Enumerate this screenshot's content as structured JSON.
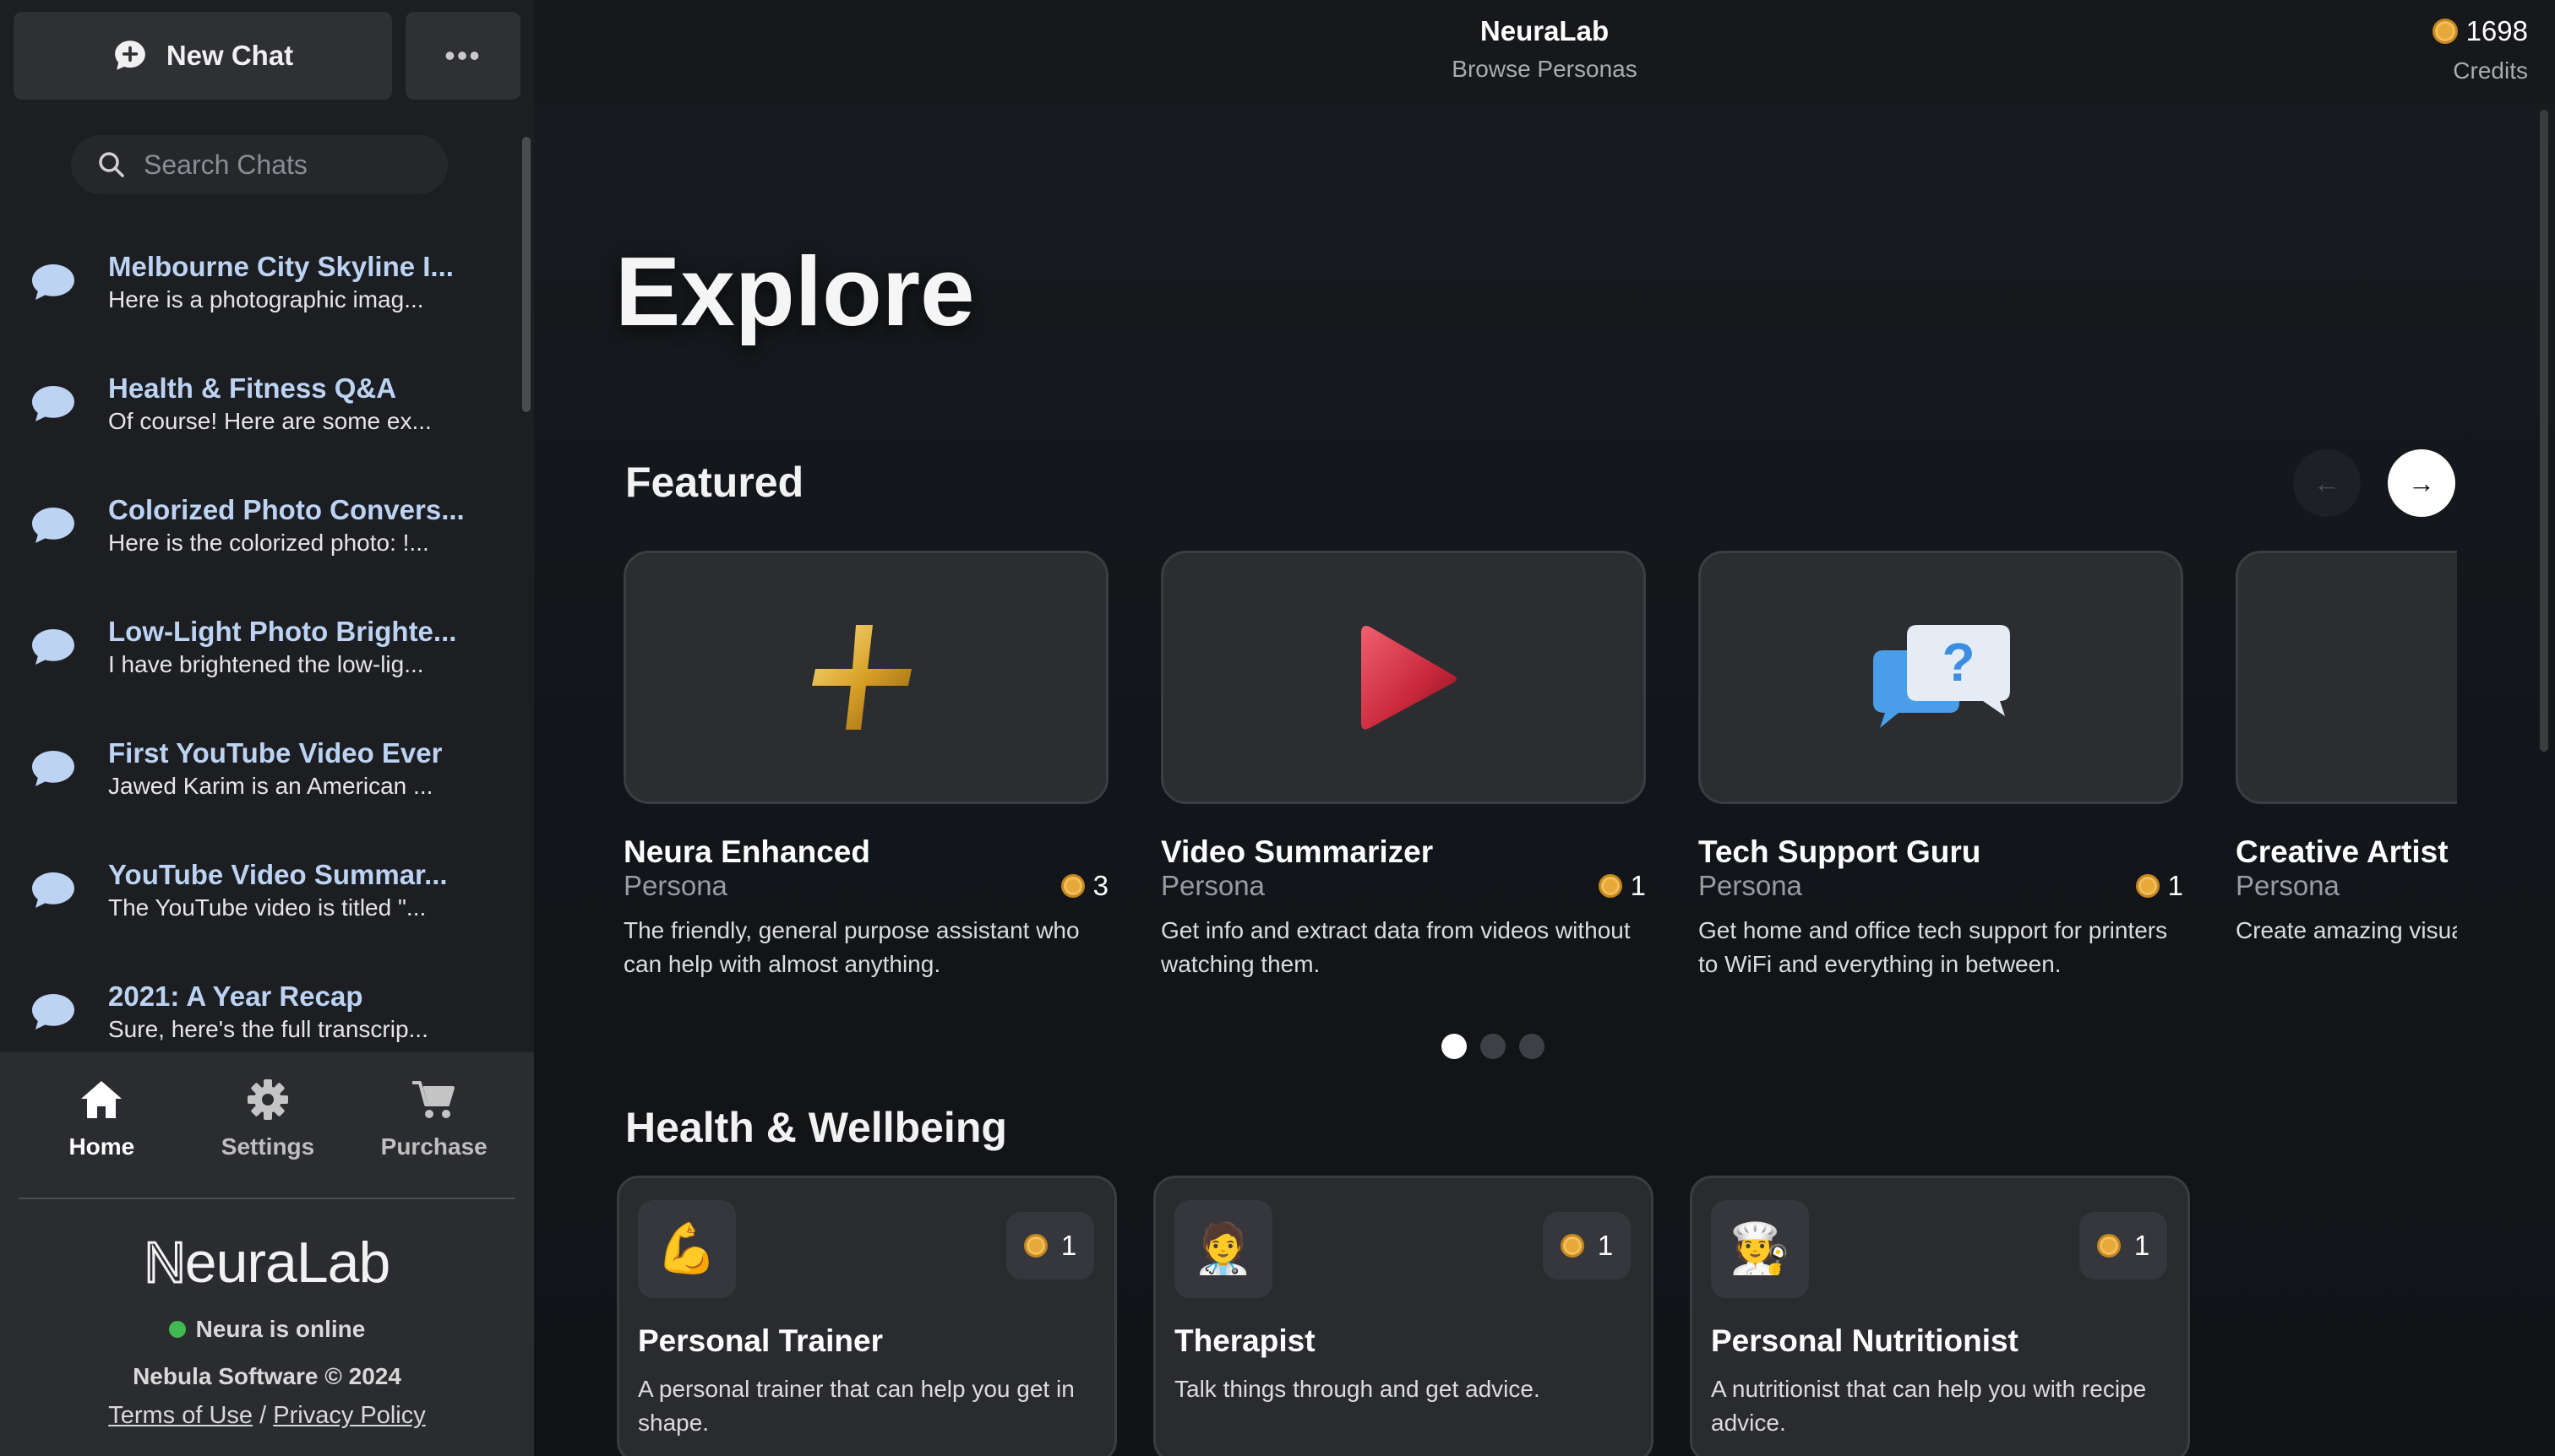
{
  "sidebar": {
    "new_chat_label": "New Chat",
    "more_label": "•••",
    "search_placeholder": "Search Chats",
    "chats": [
      {
        "title": "Melbourne City Skyline I...",
        "preview": "Here is a photographic imag..."
      },
      {
        "title": "Health & Fitness Q&A",
        "preview": "Of course! Here are some ex..."
      },
      {
        "title": "Colorized Photo Convers...",
        "preview": "Here is the colorized photo: !..."
      },
      {
        "title": "Low-Light Photo Brighte...",
        "preview": "I have brightened the low-lig..."
      },
      {
        "title": "First YouTube Video Ever",
        "preview": "Jawed Karim is an American ..."
      },
      {
        "title": "YouTube Video Summar...",
        "preview": "The YouTube video is titled \"..."
      },
      {
        "title": "2021: A Year Recap",
        "preview": "Sure, here's the full transcrip..."
      }
    ],
    "nav": {
      "home": "Home",
      "settings": "Settings",
      "purchase": "Purchase"
    },
    "logo_first": "N",
    "logo_rest": "euraLab",
    "status_text": "Neura is online",
    "copyright": "Nebula Software © 2024",
    "terms": "Terms of Use",
    "separator": "/",
    "privacy": "Privacy Policy"
  },
  "header": {
    "title": "NeuraLab",
    "subtitle": "Browse Personas",
    "credits_amount": "1698",
    "credits_label": "Credits"
  },
  "main": {
    "explore_title": "Explore",
    "featured_title": "Featured",
    "prev_arrow": "←",
    "next_arrow": "→",
    "featured": [
      {
        "name": "Neura Enhanced",
        "type": "Persona",
        "cost": "3",
        "desc": "The friendly, general purpose assistant who can help with almost anything.",
        "icon": "gold-plus-icon"
      },
      {
        "name": "Video Summarizer",
        "type": "Persona",
        "cost": "1",
        "desc": "Get info and extract data from videos without watching them.",
        "icon": "red-play-icon"
      },
      {
        "name": "Tech Support Guru",
        "type": "Persona",
        "cost": "1",
        "desc": "Get home and office tech support for printers to WiFi and everything in between.",
        "icon": "help-bubbles-icon"
      },
      {
        "name": "Creative Artist",
        "type": "Persona",
        "cost": "",
        "desc": "Create amazing visua creative muse.",
        "icon": "paint-palette-icon"
      }
    ],
    "health_title": "Health & Wellbeing",
    "health": [
      {
        "emoji": "💪",
        "cost": "1",
        "name": "Personal Trainer",
        "desc": "A personal trainer that can help you get in shape.",
        "icon": "flexed-bicep-icon"
      },
      {
        "emoji": "🧑‍⚕️",
        "cost": "1",
        "name": "Therapist",
        "desc": "Talk things through and get advice.",
        "icon": "health-worker-icon"
      },
      {
        "emoji": "🧑‍🍳",
        "cost": "1",
        "name": "Personal Nutritionist",
        "desc": "A nutritionist that can help you with recipe advice.",
        "icon": "cook-icon"
      }
    ]
  },
  "colors": {
    "background": "#121519",
    "sidebar": "#1c1e22",
    "accent_title": "#bcd3f3",
    "coin": "#e7a93a",
    "online": "#3fb950"
  }
}
